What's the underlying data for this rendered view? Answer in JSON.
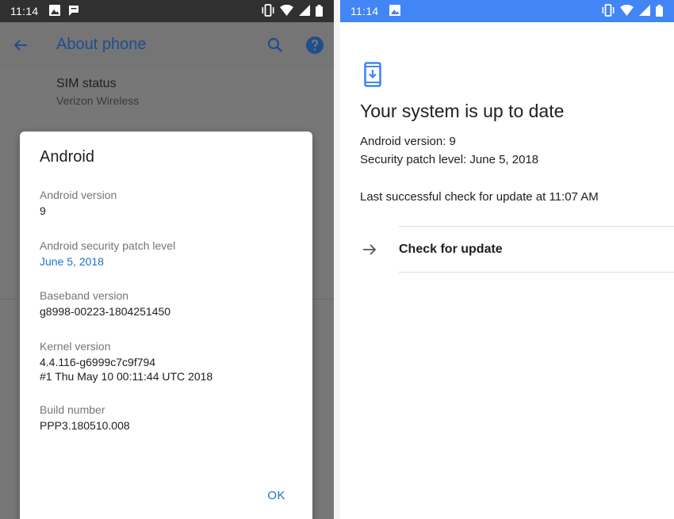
{
  "left": {
    "status_bar": {
      "time": "11:14"
    },
    "app_bar": {
      "title": "About phone"
    },
    "background_setting": {
      "title": "SIM status",
      "subtitle": "Verizon Wireless"
    },
    "dialog": {
      "title": "Android",
      "items": [
        {
          "label": "Android version",
          "value": [
            "9"
          ]
        },
        {
          "label": "Android security patch level",
          "value": [
            "June 5, 2018"
          ]
        },
        {
          "label": "Baseband version",
          "value": [
            "g8998-00223-1804251450"
          ]
        },
        {
          "label": "Kernel version",
          "value": [
            "4.4.116-g6999c7c9f794",
            "#1 Thu May 10 00:11:44 UTC 2018"
          ]
        },
        {
          "label": "Build number",
          "value": [
            "PPP3.180510.008"
          ]
        }
      ],
      "ok_label": "OK"
    }
  },
  "right": {
    "status_bar": {
      "time": "11:14"
    },
    "title": "Your system is up to date",
    "android_version": "Android version: 9",
    "security_patch": "Security patch level: June 5, 2018",
    "last_check": "Last successful check for update at 11:07 AM",
    "check_button": "Check for update"
  },
  "colors": {
    "accent_blue": "#1a73c8",
    "status_blue": "#4285f4",
    "dim_overlay": "#777777"
  },
  "icons": [
    "picture-icon",
    "message-icon",
    "vibrate-icon",
    "wifi-icon",
    "signal-icon",
    "battery-icon",
    "arrow-back-icon",
    "search-icon",
    "help-icon",
    "system-update-icon",
    "arrow-forward-icon"
  ]
}
